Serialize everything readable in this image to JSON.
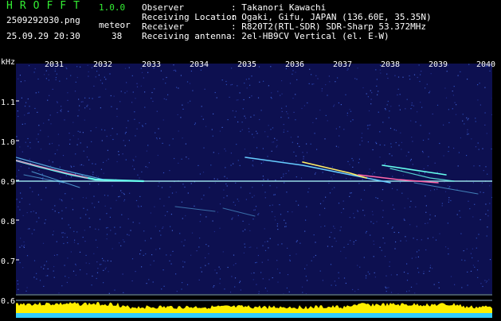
{
  "header": {
    "app_title": "HROFFT",
    "app_version": "1.0.0",
    "filename": "2509292030.png",
    "datetime": "25.09.29 20:30",
    "meteor_label": "meteor",
    "meteor_count": "38",
    "info": [
      {
        "label": "Observer",
        "value": ": Takanori Kawachi"
      },
      {
        "label": "Receiving Location",
        "value": ": Ogaki, Gifu, JAPAN (136.60E, 35.35N)"
      },
      {
        "label": "Receiver",
        "value": ": R820T2(RTL-SDR) SDR-Sharp 53.372MHz"
      },
      {
        "label": "Receiving antenna",
        "value": ": 2el-HB9CV Vertical (el. E-W)"
      }
    ]
  },
  "axes": {
    "unit": "kHz",
    "x_ticks": [
      "2031",
      "2032",
      "2033",
      "2034",
      "2035",
      "2036",
      "2037",
      "2038",
      "2039",
      "2040"
    ],
    "y_ticks": [
      "1.1",
      "1.0",
      "0.9",
      "0.8",
      "0.7",
      "0.6"
    ]
  },
  "colors": {
    "background": "#0d1050",
    "carrier": "#b0ffff",
    "meteor_hot": "#ff66aa",
    "meteor": "#66ffee",
    "level_fill": "#ffee00",
    "baseline": "#33ccff"
  }
}
